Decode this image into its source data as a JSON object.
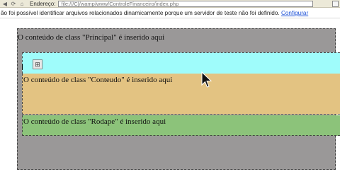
{
  "toolbar": {
    "address_label": "Endereço:",
    "address_value": "file:///C|/wamp/www/ControleFinanceiro/index.php",
    "icons": [
      "back-icon",
      "refresh-icon",
      "home-icon"
    ]
  },
  "warning": {
    "message": "ão foi possível identificar arquivos relacionados dinamicamente porque um servidor de teste não foi definido.",
    "link_label": "Configurar"
  },
  "layout_blocks": {
    "principal_text": "O conteúdo de class \"Principal\" é inserido aqui",
    "conteudo_text": "O conteúdo de class \"Conteudo\" é inserido aqui",
    "rodape_text": "O conteúdo de class \"Rodape\" é inserido aqui"
  },
  "colors": {
    "principal_bg": "#9a9898",
    "conteudo_top_bg": "#9ffcfb",
    "conteudo_bg": "#e3c382",
    "rodape_bg": "#8cc37a",
    "link": "#1a4fd6"
  }
}
